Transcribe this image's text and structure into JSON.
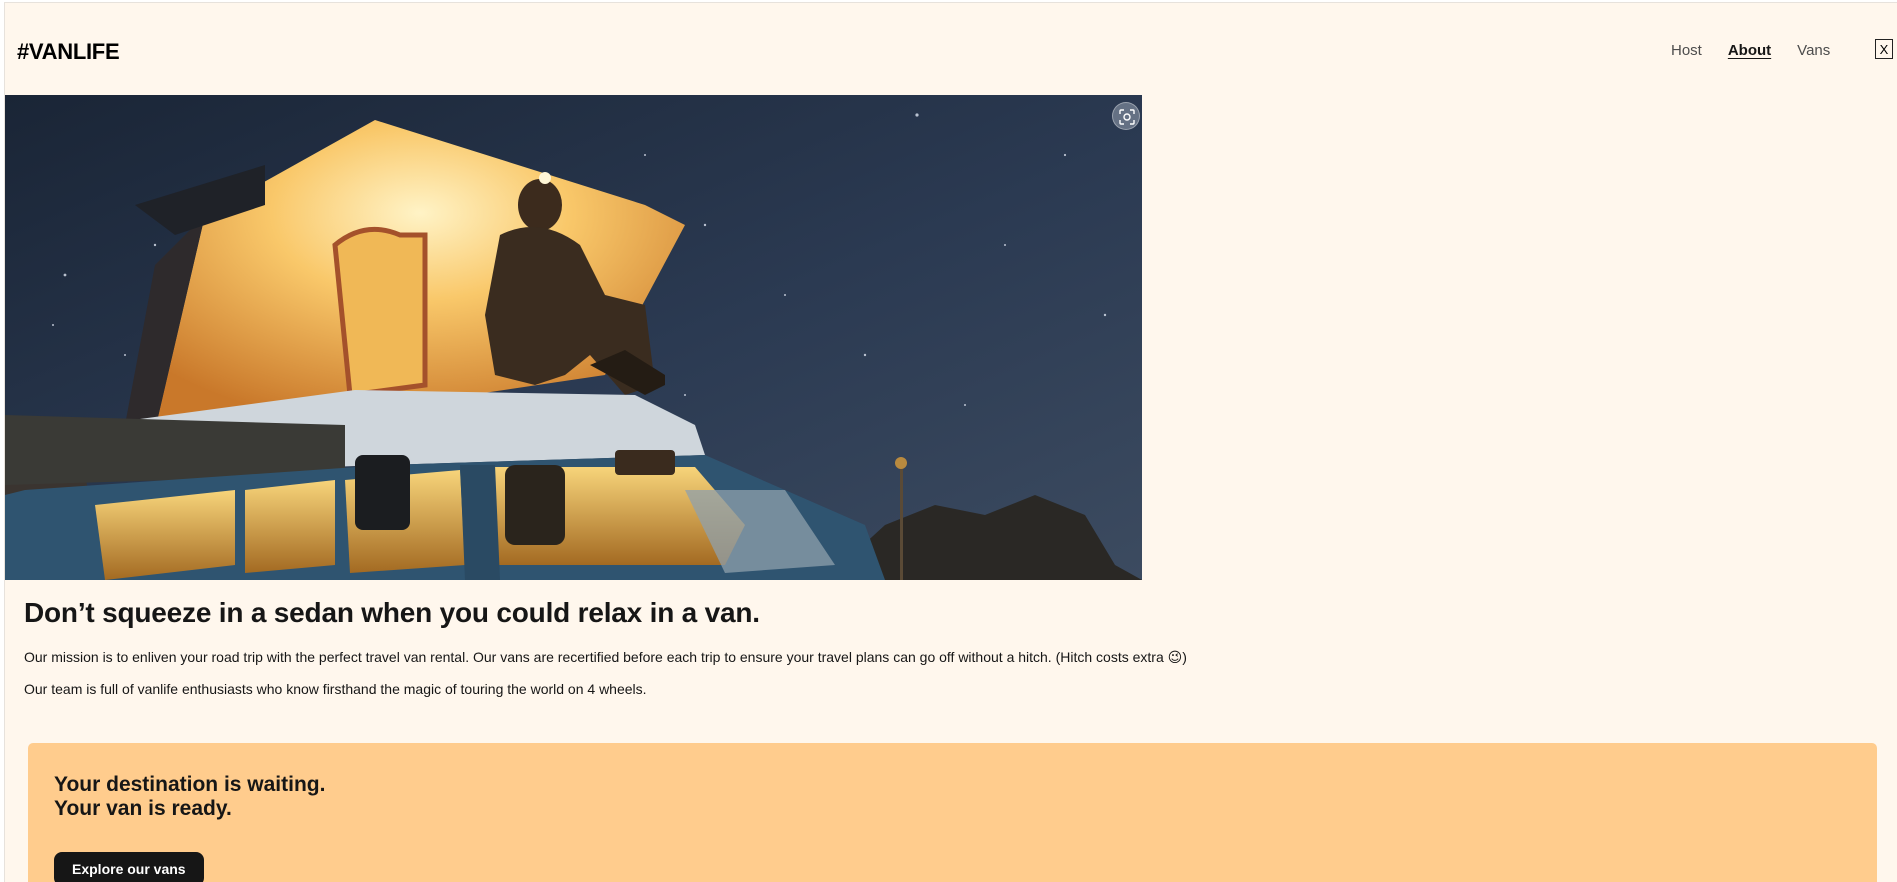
{
  "header": {
    "logo": "#VANLIFE",
    "nav": [
      {
        "label": "Host",
        "active": false
      },
      {
        "label": "About",
        "active": true
      },
      {
        "label": "Vans",
        "active": false
      }
    ],
    "close_label": "X"
  },
  "hero": {
    "icons": [
      "visual-search-icon"
    ]
  },
  "about": {
    "headline": "Don’t squeeze in a sedan when you could relax in a van.",
    "paragraph1": "Our mission is to enliven your road trip with the perfect travel van rental. Our vans are recertified before each trip to ensure your travel plans can go off without a hitch. (Hitch costs extra 😉)",
    "paragraph2": "Our team is full of vanlife enthusiasts who know firsthand the magic of touring the world on 4 wheels."
  },
  "cta": {
    "title_line1": "Your destination is waiting.",
    "title_line2": "Your van is ready.",
    "button_label": "Explore our vans"
  },
  "colors": {
    "page_bg": "#FFF7ED",
    "cta_bg": "#FFCC8D",
    "text_dark": "#161616",
    "nav_text": "#4D4D4D",
    "button_bg": "#161616"
  }
}
